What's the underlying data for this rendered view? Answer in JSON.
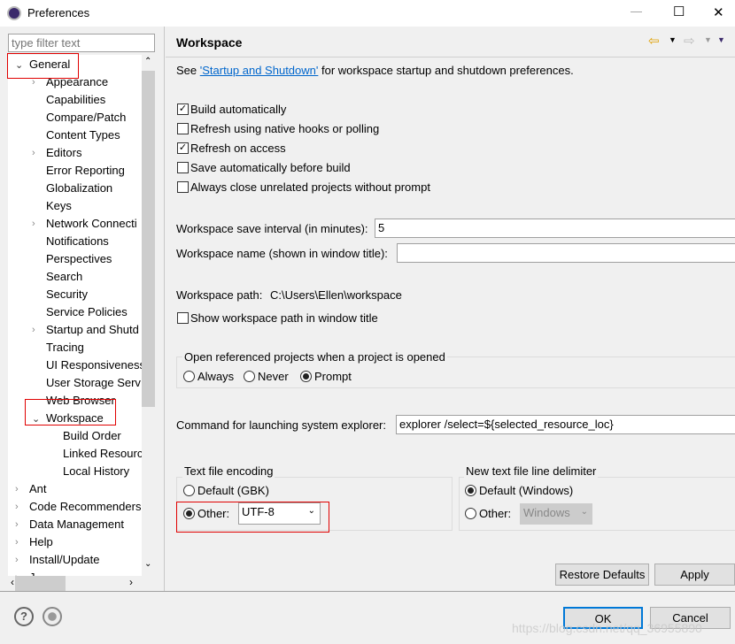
{
  "window": {
    "title": "Preferences",
    "minimize": "—",
    "maximize": "☐",
    "close": "✕"
  },
  "sidebar": {
    "filter_placeholder": "type filter text",
    "items": [
      {
        "label": "General",
        "level": 0,
        "expanded": true
      },
      {
        "label": "Appearance",
        "level": 1,
        "arrow": true
      },
      {
        "label": "Capabilities",
        "level": 1
      },
      {
        "label": "Compare/Patch",
        "level": 1
      },
      {
        "label": "Content Types",
        "level": 1
      },
      {
        "label": "Editors",
        "level": 1,
        "arrow": true
      },
      {
        "label": "Error Reporting",
        "level": 1
      },
      {
        "label": "Globalization",
        "level": 1
      },
      {
        "label": "Keys",
        "level": 1
      },
      {
        "label": "Network Connecti",
        "level": 1,
        "arrow": true
      },
      {
        "label": "Notifications",
        "level": 1
      },
      {
        "label": "Perspectives",
        "level": 1
      },
      {
        "label": "Search",
        "level": 1
      },
      {
        "label": "Security",
        "level": 1
      },
      {
        "label": "Service Policies",
        "level": 1
      },
      {
        "label": "Startup and Shutd",
        "level": 1,
        "arrow": true
      },
      {
        "label": "Tracing",
        "level": 1
      },
      {
        "label": "UI Responsiveness",
        "level": 1
      },
      {
        "label": "User Storage Serv",
        "level": 1
      },
      {
        "label": "Web Browser",
        "level": 1
      },
      {
        "label": "Workspace",
        "level": 1,
        "expanded": true,
        "selected": true
      },
      {
        "label": "Build Order",
        "level": 2
      },
      {
        "label": "Linked Resourc",
        "level": 2
      },
      {
        "label": "Local History",
        "level": 2
      },
      {
        "label": "Ant",
        "level": 0,
        "arrow": true
      },
      {
        "label": "Code Recommenders",
        "level": 0,
        "arrow": true
      },
      {
        "label": "Data Management",
        "level": 0,
        "arrow": true
      },
      {
        "label": "Help",
        "level": 0,
        "arrow": true
      },
      {
        "label": "Install/Update",
        "level": 0,
        "arrow": true
      },
      {
        "label": "J",
        "level": 0,
        "arrow": true
      }
    ]
  },
  "page": {
    "title": "Workspace",
    "intro_pre": "See ",
    "intro_link": "'Startup and Shutdown'",
    "intro_post": " for workspace startup and shutdown preferences.",
    "checks": [
      {
        "label": "Build automatically",
        "checked": true
      },
      {
        "label": "Refresh using native hooks or polling",
        "checked": false
      },
      {
        "label": "Refresh on access",
        "checked": true
      },
      {
        "label": "Save automatically before build",
        "checked": false
      },
      {
        "label": "Always close unrelated projects without prompt",
        "checked": false
      }
    ],
    "save_interval_label": "Workspace save interval (in minutes):",
    "save_interval_value": "5",
    "ws_name_label": "Workspace name (shown in window title):",
    "ws_name_value": "",
    "ws_path_label": "Workspace path:",
    "ws_path_value": "C:\\Users\\Ellen\\workspace",
    "show_path_label": "Show workspace path in window title",
    "show_path_checked": false,
    "open_ref": {
      "title": "Open referenced projects when a project is opened",
      "options": [
        "Always",
        "Never",
        "Prompt"
      ],
      "selected": "Prompt"
    },
    "explorer_label": "Command for launching system explorer:",
    "explorer_value": "explorer /select=${selected_resource_loc}",
    "encoding": {
      "title": "Text file encoding",
      "default_label": "Default (GBK)",
      "other_label": "Other:",
      "value": "UTF-8",
      "selected": "Other"
    },
    "delimiter": {
      "title": "New text file line delimiter",
      "default_label": "Default (Windows)",
      "other_label": "Other:",
      "value": "Windows",
      "selected": "Default"
    },
    "restore_label": "Restore Defaults",
    "apply_label": "Apply"
  },
  "footer": {
    "ok_label": "OK",
    "cancel_label": "Cancel",
    "watermark": "https://blog.csdn.net/qq_36955890"
  },
  "colors": {
    "link": "#0066cc",
    "highlight": "#e00000",
    "ok_border": "#0078d7"
  }
}
